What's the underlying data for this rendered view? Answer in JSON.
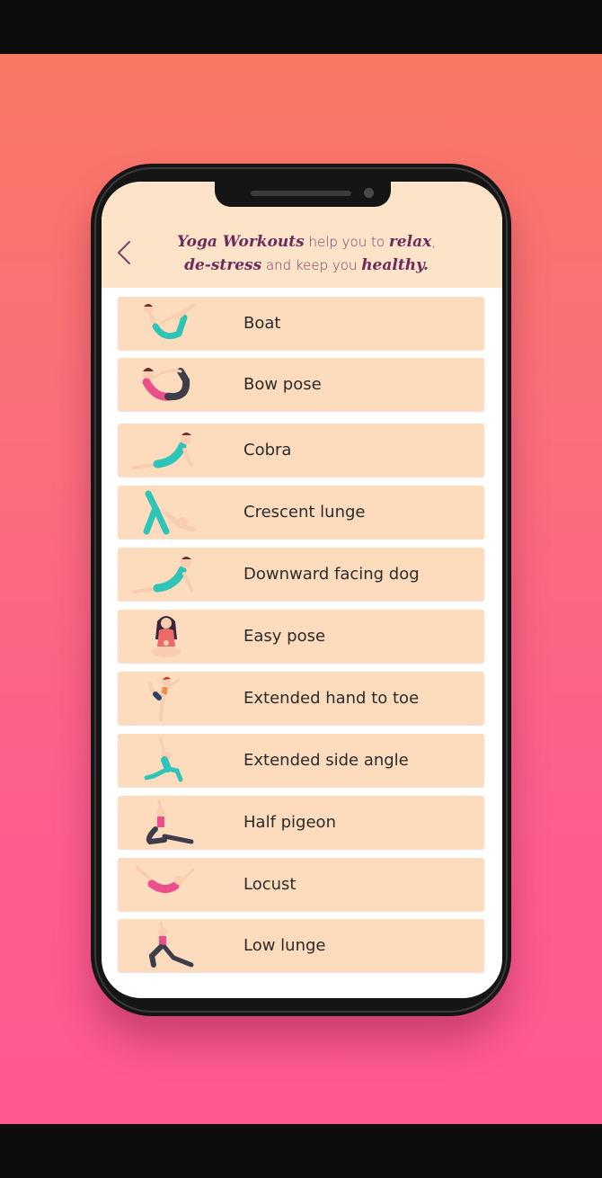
{
  "header": {
    "back_icon": "chevron-left-icon",
    "tagline": {
      "part1": "Yoga Workouts",
      "part2": " help you to ",
      "part3": "relax",
      "part4": ",",
      "part5": "de-stress",
      "part6": " and keep you ",
      "part7": "healthy."
    }
  },
  "poses": [
    {
      "label": "Boat",
      "icon": "boat-pose-figure"
    },
    {
      "label": "Bow pose",
      "icon": "bow-pose-figure"
    },
    {
      "label": "Cobra",
      "icon": "cobra-pose-figure"
    },
    {
      "label": "Crescent lunge",
      "icon": "crescent-lunge-figure"
    },
    {
      "label": "Downward facing dog",
      "icon": "downward-dog-figure"
    },
    {
      "label": "Easy pose",
      "icon": "easy-pose-figure"
    },
    {
      "label": "Extended hand to toe",
      "icon": "hand-to-toe-figure"
    },
    {
      "label": "Extended side angle",
      "icon": "side-angle-figure"
    },
    {
      "label": "Half pigeon",
      "icon": "half-pigeon-figure"
    },
    {
      "label": "Locust",
      "icon": "locust-pose-figure"
    },
    {
      "label": "Low lunge",
      "icon": "low-lunge-figure"
    }
  ],
  "colors": {
    "background_top": "#f87865",
    "background_bottom": "#fd5890",
    "header_bg": "#fde3c8",
    "row_bg": "#fddcbe",
    "accent_text": "#6b2a5c",
    "teal": "#2fc4b8",
    "pink": "#ec4e8c",
    "skin": "#f9cdb0",
    "hair": "#6a2c2f"
  }
}
